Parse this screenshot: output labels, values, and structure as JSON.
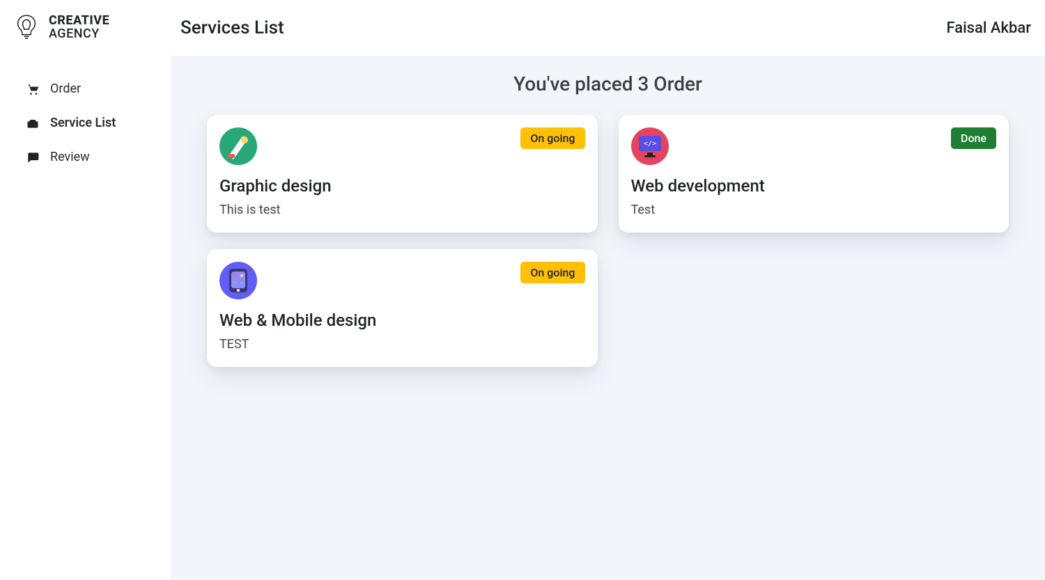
{
  "brand": {
    "line1": "CREATIVE",
    "line2": "AGENCY"
  },
  "sidebar": {
    "items": [
      {
        "label": "Order",
        "icon": "cart-icon"
      },
      {
        "label": "Service List",
        "icon": "toolbox-icon"
      },
      {
        "label": "Review",
        "icon": "chat-icon"
      }
    ],
    "active_index": 1
  },
  "header": {
    "page_title": "Services List",
    "user_name": "Faisal Akbar"
  },
  "summary_text": "You've placed 3 Order",
  "orders": [
    {
      "title": "Graphic design",
      "description": "This is test",
      "status_label": "On going",
      "status": "ongoing",
      "icon": "palette-icon",
      "icon_bg": "#28a879"
    },
    {
      "title": "Web development",
      "description": "Test",
      "status_label": "Done",
      "status": "done",
      "icon": "monitor-code-icon",
      "icon_bg": "#e64360"
    },
    {
      "title": "Web & Mobile design",
      "description": "TEST",
      "status_label": "On going",
      "status": "ongoing",
      "icon": "mobile-design-icon",
      "icon_bg": "#625df5"
    }
  ],
  "status_colors": {
    "ongoing": "#ffc107",
    "done": "#1e7e34"
  }
}
